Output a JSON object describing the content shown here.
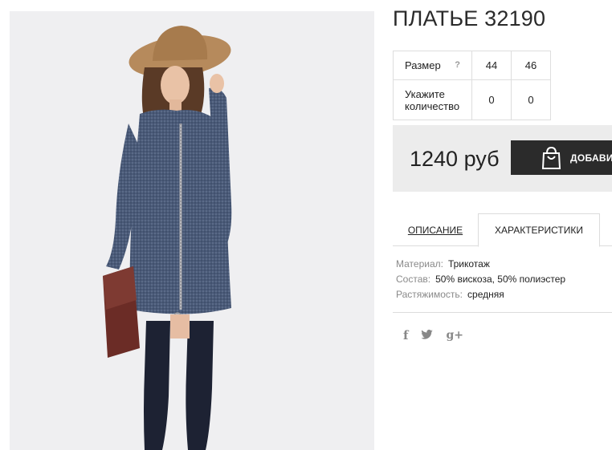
{
  "product": {
    "title": "ПЛАТЬЕ 32190",
    "image_alt": "dress-photo"
  },
  "sizes": {
    "size_label": "Размер",
    "help_label": "?",
    "size_values": [
      "44",
      "46"
    ],
    "qty_label": "Укажите количество",
    "qty_values": [
      "0",
      "0"
    ]
  },
  "buy": {
    "price": "1240 руб",
    "add_label": "ДОБАВИТЬ В КОРЗИНУ",
    "icon": "shopping-bag-icon"
  },
  "tabs": [
    {
      "label": "ОПИСАНИЕ",
      "active": false
    },
    {
      "label": "ХАРАКТЕРИСТИКИ",
      "active": true
    }
  ],
  "specs": [
    {
      "key": "Материал:",
      "value": "Трикотаж"
    },
    {
      "key": "Состав:",
      "value": "50% вискоза, 50% полиэстер"
    },
    {
      "key": "Растяжимость:",
      "value": "средняя"
    }
  ],
  "social": {
    "facebook": "f",
    "twitter": "twitter",
    "gplus": "g+",
    "icons": [
      "facebook-icon",
      "twitter-icon",
      "google-plus-icon"
    ]
  }
}
